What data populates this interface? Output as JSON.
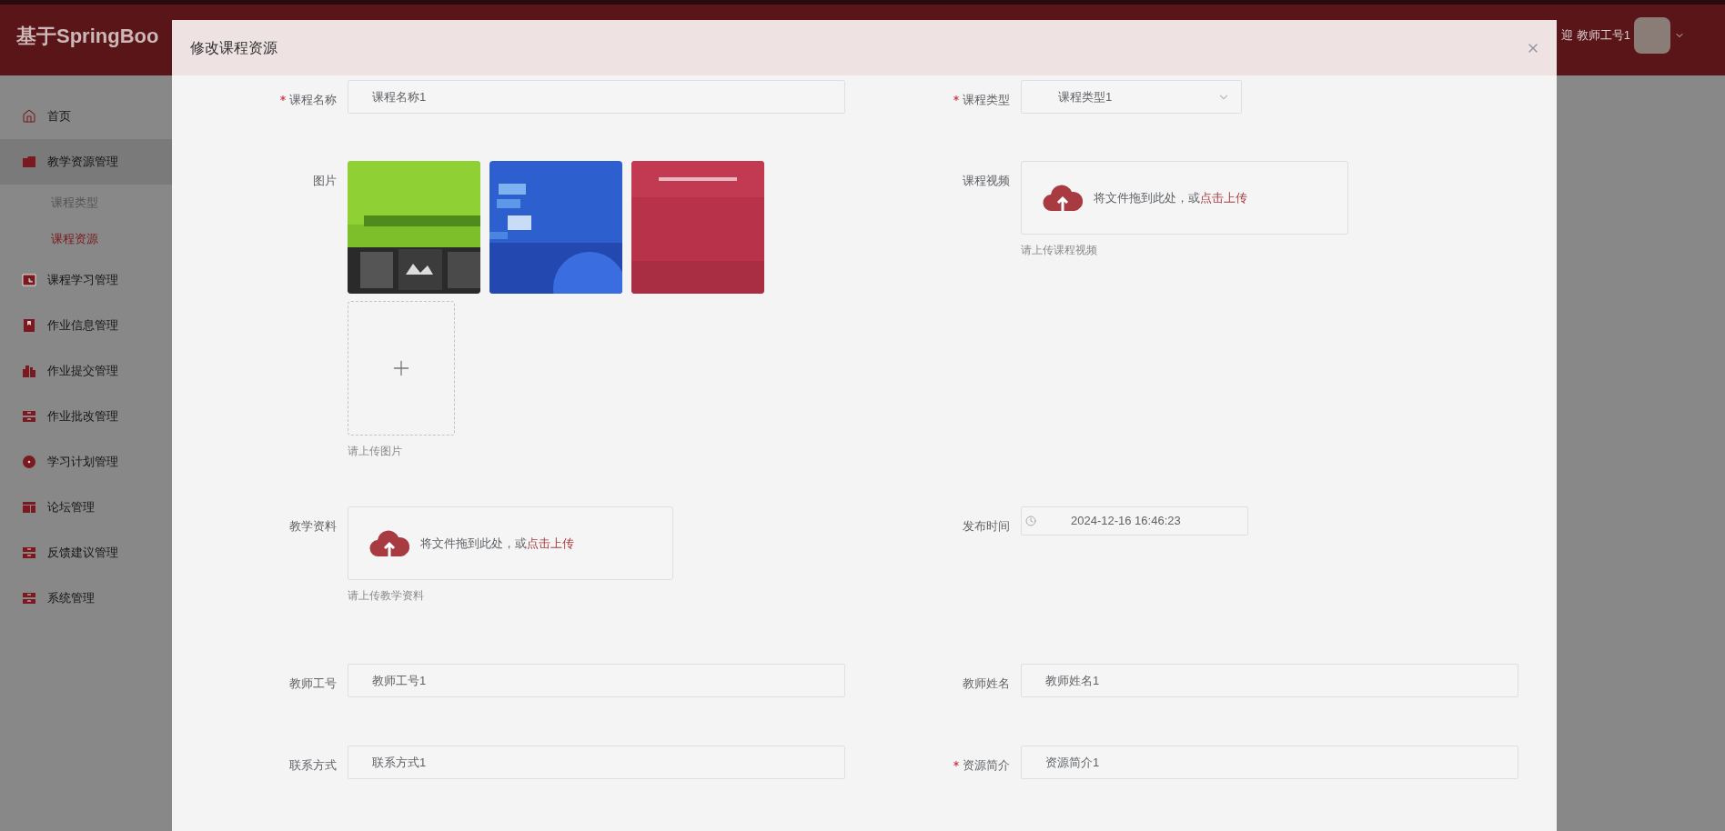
{
  "header": {
    "title": "基于SpringBoo",
    "welcome": "迎 教师工号1"
  },
  "sidebar": {
    "items": [
      {
        "label": "首页",
        "expanded": false
      },
      {
        "label": "教学资源管理",
        "expanded": true,
        "children": [
          {
            "label": "课程类型",
            "selected": false
          },
          {
            "label": "课程资源",
            "selected": true
          }
        ]
      },
      {
        "label": "课程学习管理",
        "expanded": false
      },
      {
        "label": "作业信息管理",
        "expanded": false
      },
      {
        "label": "作业提交管理",
        "expanded": false
      },
      {
        "label": "作业批改管理",
        "expanded": false
      },
      {
        "label": "学习计划管理",
        "expanded": false
      },
      {
        "label": "论坛管理",
        "expanded": false
      },
      {
        "label": "反馈建议管理",
        "expanded": false
      },
      {
        "label": "系统管理",
        "expanded": false
      }
    ]
  },
  "dialog": {
    "title": "修改课程资源",
    "rows": [
      [
        {
          "kind": "text",
          "label": "课程名称",
          "required": true,
          "value": "课程名称1"
        },
        {
          "kind": "select",
          "label": "课程类型",
          "required": true,
          "value": "课程类型1"
        }
      ],
      [
        {
          "kind": "images",
          "label": "图片",
          "required": false,
          "hint": "请上传图片"
        },
        {
          "kind": "upload",
          "label": "课程视频",
          "required": false,
          "prompt": "将文件拖到此处，或",
          "link": "点击上传",
          "hint": "请上传课程视频"
        }
      ],
      [
        {
          "kind": "upload",
          "label": "教学资料",
          "required": false,
          "prompt": "将文件拖到此处，或",
          "link": "点击上传",
          "hint": "请上传教学资料"
        },
        {
          "kind": "date",
          "label": "发布时间",
          "required": false,
          "value": "2024-12-16 16:46:23"
        }
      ],
      [
        {
          "kind": "text",
          "label": "教师工号",
          "required": false,
          "value": "教师工号1"
        },
        {
          "kind": "text",
          "label": "教师姓名",
          "required": false,
          "value": "教师姓名1"
        }
      ],
      [
        {
          "kind": "text",
          "label": "联系方式",
          "required": false,
          "value": "联系方式1"
        },
        {
          "kind": "text",
          "label": "资源简介",
          "required": true,
          "value": "资源简介1"
        }
      ]
    ]
  }
}
